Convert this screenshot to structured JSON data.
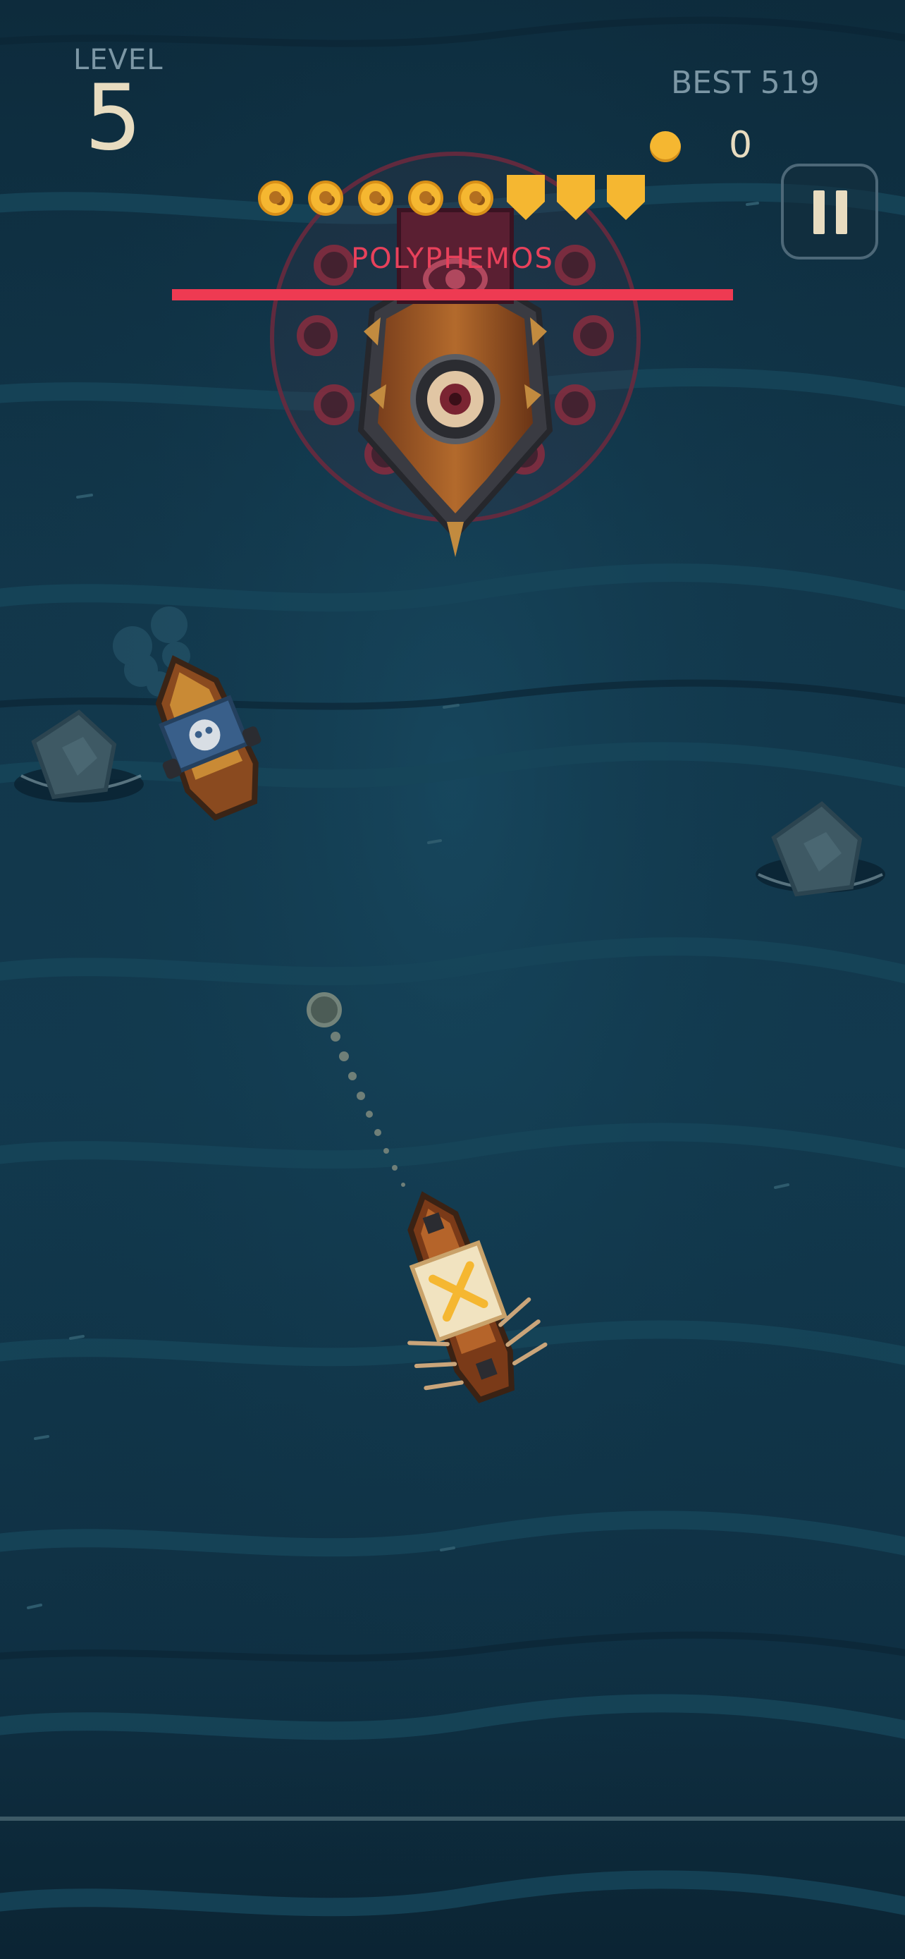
{
  "hud": {
    "level_label": "LEVEL",
    "level_number": "5",
    "best_label": "BEST 519",
    "coin_count": "0"
  },
  "boss": {
    "name": "POLYPHEMOS",
    "health_fraction": 1.0
  },
  "ammo": {
    "coins_loaded": 5,
    "shields": 3
  },
  "icons": {
    "coin": "coin-icon",
    "pause": "pause-icon",
    "ammo_coin": "ammo-coin-icon",
    "shield": "shield-icon"
  },
  "colors": {
    "sea_dark": "#0d2b3c",
    "sea_mid": "#123a4f",
    "boss_red": "#ee3a52",
    "gold": "#f5b731",
    "hud_text": "#7c97a5",
    "cream": "#e8dcc0"
  }
}
